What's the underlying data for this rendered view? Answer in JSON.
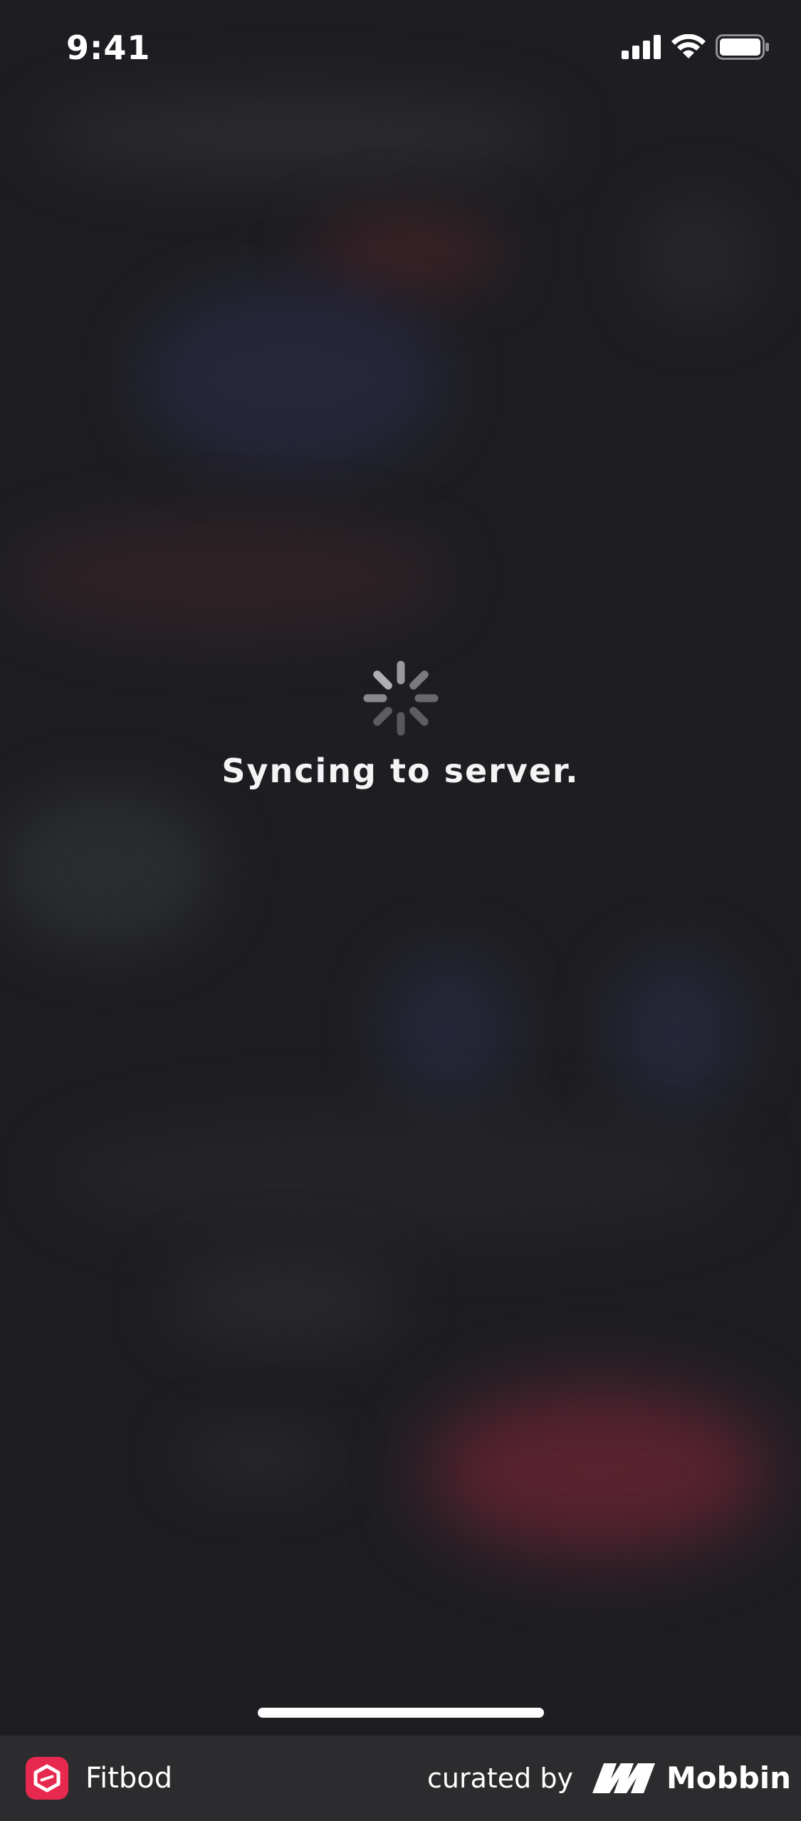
{
  "status_bar": {
    "time": "9:41"
  },
  "loading": {
    "message": "Syncing to server."
  },
  "footer": {
    "app_name": "Fitbod",
    "curated_label": "curated by",
    "brand_name": "Mobbin"
  },
  "colors": {
    "background": "#1e1e22",
    "footer_background": "#2c2c2e",
    "app_logo": "#e8294f",
    "spinner": "#8e8e93"
  },
  "icons": {
    "signal": "cellular-signal-icon",
    "wifi": "wifi-icon",
    "battery": "battery-icon",
    "spinner": "activity-spinner-icon",
    "app_logo": "fitbod-logo-icon",
    "brand_logo": "mobbin-logo-icon"
  }
}
